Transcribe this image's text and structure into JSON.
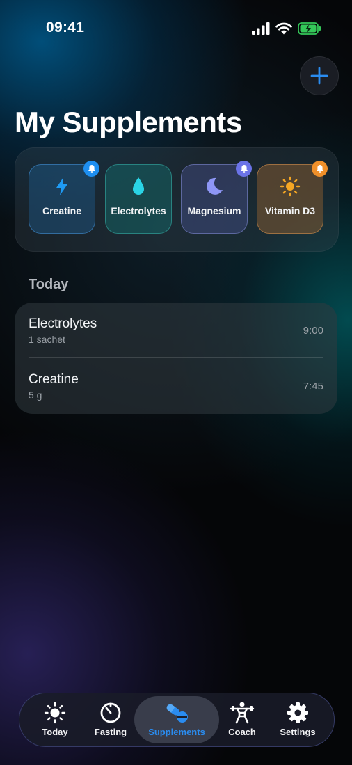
{
  "status_bar": {
    "time": "09:41",
    "icons": [
      "signal-icon",
      "wifi-icon",
      "battery-charging-icon"
    ]
  },
  "header": {
    "title": "My Supplements",
    "add_icon": "plus-icon"
  },
  "supplements": [
    {
      "label": "Creatine",
      "icon": "bolt-icon",
      "color": "#1e9bf5",
      "reminder": true,
      "bell_color": "#1e8ff0"
    },
    {
      "label": "Electrolytes",
      "icon": "drop-icon",
      "color": "#2ad4e6",
      "reminder": false
    },
    {
      "label": "Magnesium",
      "icon": "moon-icon",
      "color": "#8e96f5",
      "reminder": true,
      "bell_color": "#6b73e8"
    },
    {
      "label": "Vitamin D3",
      "icon": "sun-icon",
      "color": "#f5a623",
      "reminder": true,
      "bell_color": "#f0902a"
    }
  ],
  "today": {
    "label": "Today",
    "entries": [
      {
        "name": "Electrolytes",
        "dose": "1 sachet",
        "time": "9:00"
      },
      {
        "name": "Creatine",
        "dose": "5 g",
        "time": "7:45"
      }
    ]
  },
  "tabbar": {
    "active": "Supplements",
    "tabs": [
      {
        "label": "Today",
        "icon": "sun-icon"
      },
      {
        "label": "Fasting",
        "icon": "timer-icon"
      },
      {
        "label": "Supplements",
        "icon": "pills-icon"
      },
      {
        "label": "Coach",
        "icon": "weightlifter-icon"
      },
      {
        "label": "Settings",
        "icon": "gear-icon"
      }
    ]
  },
  "colors": {
    "accent": "#2a8cf0",
    "battery": "#34c759"
  }
}
